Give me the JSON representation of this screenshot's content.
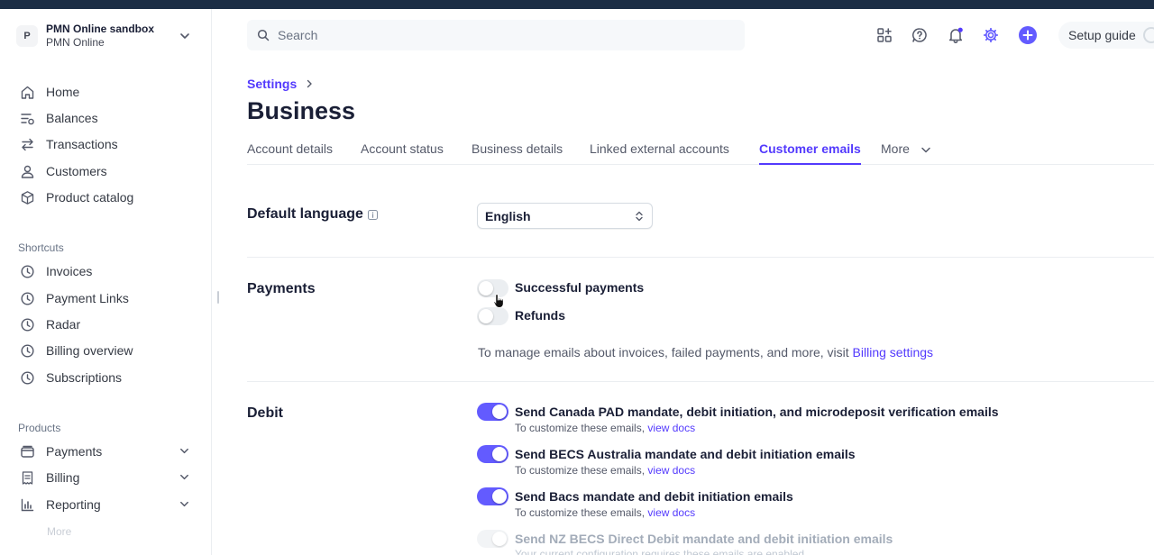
{
  "account": {
    "initial": "P",
    "name": "PMN Online sandbox",
    "subtitle": "PMN Online"
  },
  "sidebar": {
    "main": [
      {
        "label": "Home",
        "icon": "home-icon"
      },
      {
        "label": "Balances",
        "icon": "balances-icon"
      },
      {
        "label": "Transactions",
        "icon": "transactions-icon"
      },
      {
        "label": "Customers",
        "icon": "customers-icon"
      },
      {
        "label": "Product catalog",
        "icon": "product-catalog-icon"
      }
    ],
    "shortcuts_label": "Shortcuts",
    "shortcuts": [
      {
        "label": "Invoices",
        "icon": "clock-icon"
      },
      {
        "label": "Payment Links",
        "icon": "clock-icon"
      },
      {
        "label": "Radar",
        "icon": "clock-icon"
      },
      {
        "label": "Billing overview",
        "icon": "clock-icon"
      },
      {
        "label": "Subscriptions",
        "icon": "clock-icon"
      }
    ],
    "products_label": "Products",
    "products": [
      {
        "label": "Payments",
        "icon": "payments-icon"
      },
      {
        "label": "Billing",
        "icon": "billing-icon"
      },
      {
        "label": "Reporting",
        "icon": "reporting-icon"
      }
    ],
    "faded_more": "More"
  },
  "header": {
    "search_placeholder": "Search",
    "setup_guide": "Setup guide",
    "accent": "#635bff"
  },
  "page": {
    "breadcrumb": "Settings",
    "title": "Business",
    "tabs": [
      {
        "label": "Account details",
        "active": false
      },
      {
        "label": "Account status",
        "active": false
      },
      {
        "label": "Business details",
        "active": false
      },
      {
        "label": "Linked external accounts",
        "active": false
      },
      {
        "label": "Customer emails",
        "active": true
      },
      {
        "label": "More",
        "active": false
      }
    ]
  },
  "default_language": {
    "label": "Default language",
    "value": "English"
  },
  "payments": {
    "label": "Payments",
    "options": [
      {
        "label": "Successful payments",
        "enabled": false
      },
      {
        "label": "Refunds",
        "enabled": false
      }
    ],
    "note_prefix": "To manage emails about invoices, failed payments, and more, visit",
    "note_link": "Billing settings"
  },
  "debit": {
    "label": "Debit",
    "help_prefix": "To customize these emails,",
    "help_link": "view docs",
    "options": [
      {
        "label": "Send Canada PAD mandate, debit initiation, and microdeposit verification emails",
        "enabled": true
      },
      {
        "label": "Send BECS Australia mandate and debit initiation emails",
        "enabled": true
      },
      {
        "label": "Send Bacs mandate and debit initiation emails",
        "enabled": true
      },
      {
        "label": "Send NZ BECS Direct Debit mandate and debit initiation emails",
        "enabled": true,
        "disabled": true,
        "help": "Your current configuration requires these emails are enabled"
      }
    ]
  }
}
